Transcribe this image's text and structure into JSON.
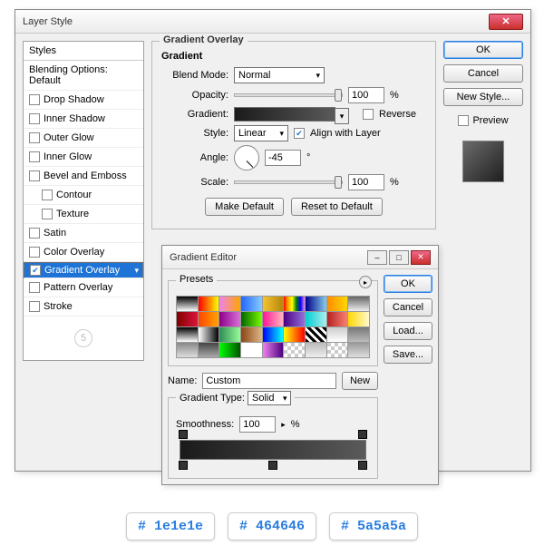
{
  "main": {
    "title": "Layer Style",
    "styles": {
      "header": "Styles",
      "blend": "Blending Options: Default",
      "items": [
        {
          "label": "Drop Shadow",
          "on": false
        },
        {
          "label": "Inner Shadow",
          "on": false
        },
        {
          "label": "Outer Glow",
          "on": false
        },
        {
          "label": "Inner Glow",
          "on": false
        },
        {
          "label": "Bevel and Emboss",
          "on": false
        },
        {
          "label": "Contour",
          "on": false,
          "sub": true
        },
        {
          "label": "Texture",
          "on": false,
          "sub": true
        },
        {
          "label": "Satin",
          "on": false
        },
        {
          "label": "Color Overlay",
          "on": false
        },
        {
          "label": "Gradient Overlay",
          "on": true,
          "sel": true
        },
        {
          "label": "Pattern Overlay",
          "on": false
        },
        {
          "label": "Stroke",
          "on": false
        }
      ],
      "badge": "5"
    },
    "group": {
      "legend": "Gradient Overlay",
      "sub": "Gradient",
      "blend_lbl": "Blend Mode:",
      "blend_val": "Normal",
      "opacity_lbl": "Opacity:",
      "opacity_val": "100",
      "pct": "%",
      "gradient_lbl": "Gradient:",
      "reverse": "Reverse",
      "style_lbl": "Style:",
      "style_val": "Linear",
      "align": "Align with Layer",
      "angle_lbl": "Angle:",
      "angle_val": "-45",
      "deg": "°",
      "scale_lbl": "Scale:",
      "scale_val": "100",
      "make": "Make Default",
      "reset": "Reset to Default"
    },
    "side": {
      "ok": "OK",
      "cancel": "Cancel",
      "new": "New Style...",
      "preview": "Preview"
    }
  },
  "ge": {
    "title": "Gradient Editor",
    "ok": "OK",
    "cancel": "Cancel",
    "load": "Load...",
    "save": "Save...",
    "presets": "Presets",
    "name_lbl": "Name:",
    "name_val": "Custom",
    "new": "New",
    "gtype_lbl": "Gradient Type:",
    "gtype_val": "Solid",
    "smooth_lbl": "Smoothness:",
    "smooth_val": "100",
    "pct": "%",
    "presetColors": [
      "linear-gradient(#000,#fff)",
      "linear-gradient(90deg,red,yellow)",
      "linear-gradient(90deg,violet,orange)",
      "linear-gradient(90deg,#26f,#8cf)",
      "linear-gradient(90deg,#f4c430,#b8860b)",
      "linear-gradient(90deg,red,orange,yellow,green,blue,violet)",
      "linear-gradient(90deg,#00008b,#87ceeb)",
      "linear-gradient(90deg,#ff8c00,#ffd700)",
      "linear-gradient(#666,#eee)",
      "linear-gradient(90deg,#800000,#dc143c)",
      "linear-gradient(90deg,#ff4500,#ffa500)",
      "linear-gradient(90deg,#8b008b,#da70d6)",
      "linear-gradient(90deg,#006400,#7cfc00)",
      "linear-gradient(90deg,#ff1493,#ffb6c1)",
      "linear-gradient(90deg,#4b0082,#9370db)",
      "linear-gradient(90deg,#00ced1,#afeeee)",
      "linear-gradient(90deg,#b22222,#fa8072)",
      "linear-gradient(90deg,#ffd700,#fffacd)",
      "linear-gradient(#000,#fff)",
      "linear-gradient(90deg,#fff,#000)",
      "linear-gradient(90deg,#2e8b57,#98fb98)",
      "linear-gradient(90deg,#8b4513,#deb887)",
      "linear-gradient(90deg,#00f,#0ff)",
      "linear-gradient(90deg,#ff0,#f00)",
      "repeating-linear-gradient(45deg,#000 0 3px,#fff 3px 6px)",
      "linear-gradient(#ccc,#fff)",
      "linear-gradient(#777,#bbb)",
      "linear-gradient(#888,#ddd)",
      "linear-gradient(#444,#aaa)",
      "linear-gradient(90deg,#0f0,#050)",
      "linear-gradient(#fff,#fff)",
      "linear-gradient(90deg,#ee82ee,#4b0082)",
      "repeating-conic-gradient(#ccc 0 25%,#fff 0 50%) 0/8px 8px",
      "linear-gradient(#bbb,#eee)",
      "repeating-conic-gradient(#ccc 0 25%,#fff 0 50%) 0/8px 8px",
      "linear-gradient(#999,#ddd)"
    ]
  },
  "hex": [
    "# 1e1e1e",
    "# 464646",
    "# 5a5a5a"
  ]
}
